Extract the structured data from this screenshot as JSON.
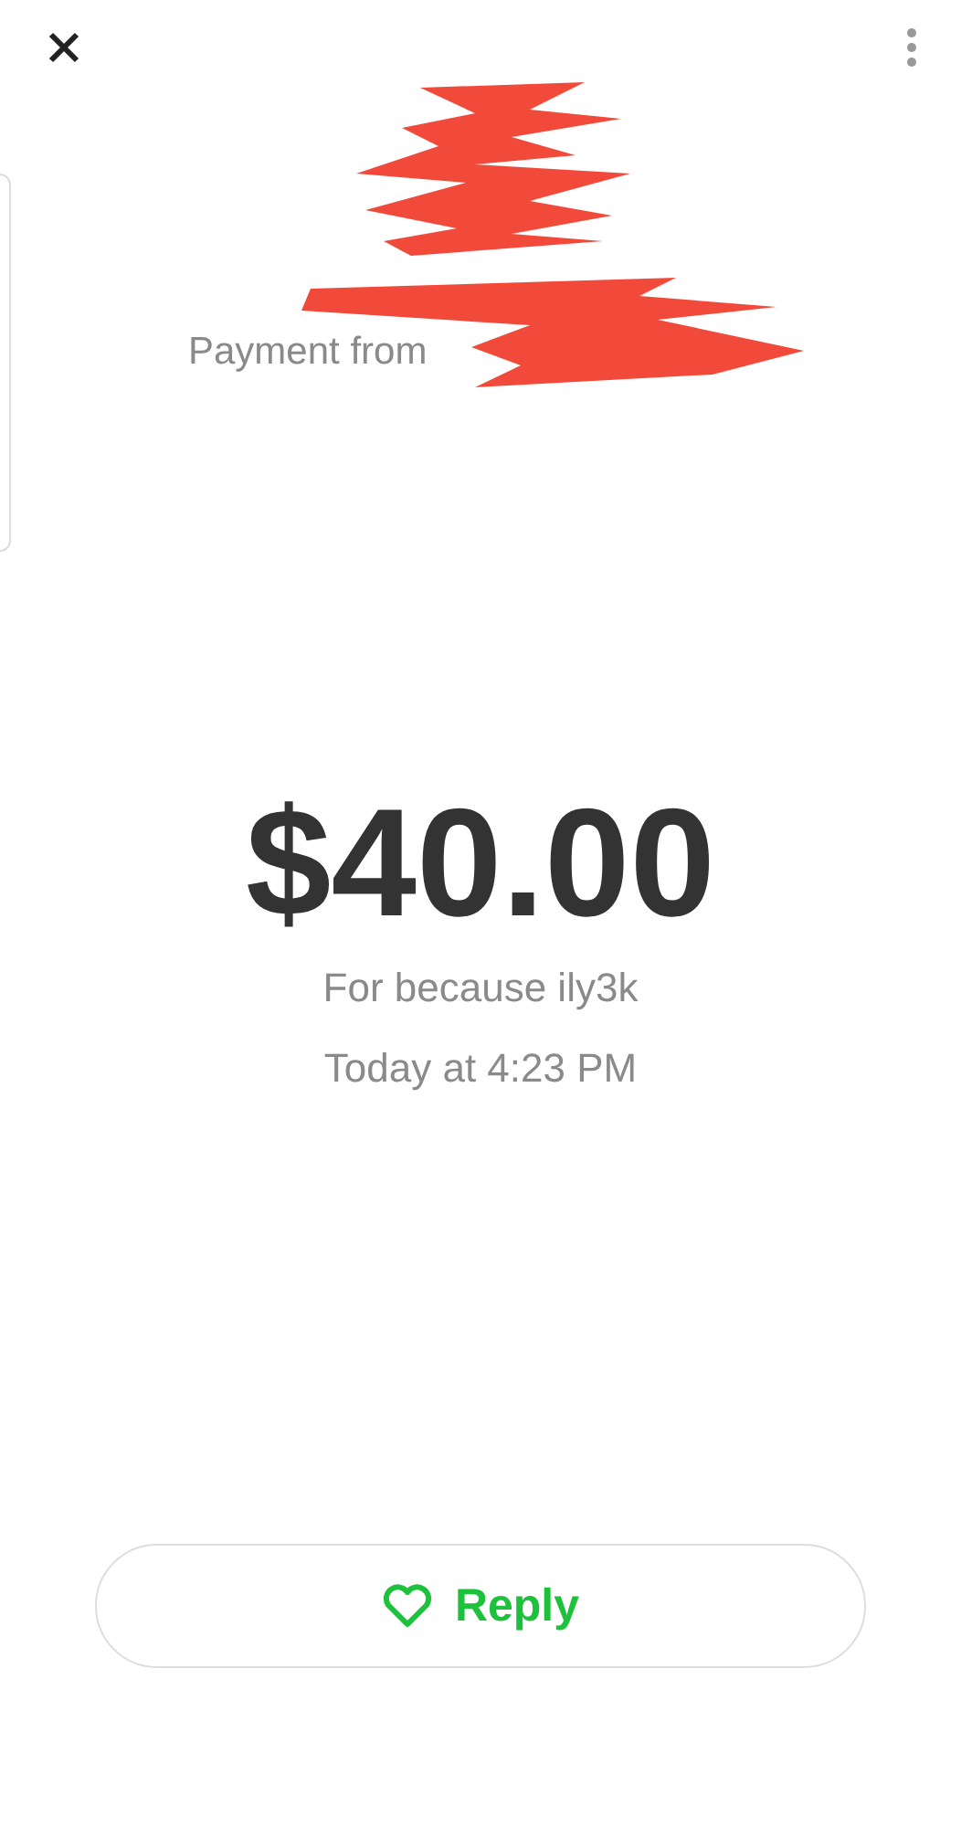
{
  "sender": {
    "label": "Payment from"
  },
  "payment": {
    "amount": "$40.00",
    "note": "For because ily3k",
    "time": "Today at 4:23 PM"
  },
  "reply_button": {
    "label": "Reply"
  }
}
